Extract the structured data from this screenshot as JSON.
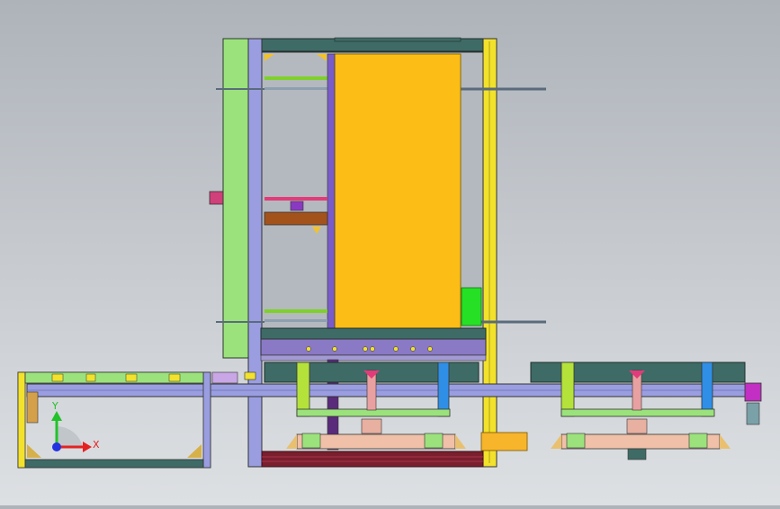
{
  "viewport": {
    "model": "assembly-top-view",
    "colors": {
      "background_top": "#aeb3ba",
      "background_bottom": "#dde0e3",
      "frame_yellow": "#f2e22c",
      "frame_lavender": "#9a9ee0",
      "panel_orange": "#fbbd16",
      "panel_green": "#9be27c",
      "beam_teal": "#3f6b66",
      "rod_green": "#7fd12a",
      "rod_magenta": "#e23b7a",
      "base_maroon": "#7a1f2e",
      "accent_blue": "#2f8fe6",
      "accent_bright_green": "#26e026",
      "accent_purple": "#c22fc2"
    }
  },
  "triad": {
    "x_label": "X",
    "y_label": "Y",
    "x_color": "#e42222",
    "y_color": "#22c22a",
    "z_color": "#2233e0"
  }
}
